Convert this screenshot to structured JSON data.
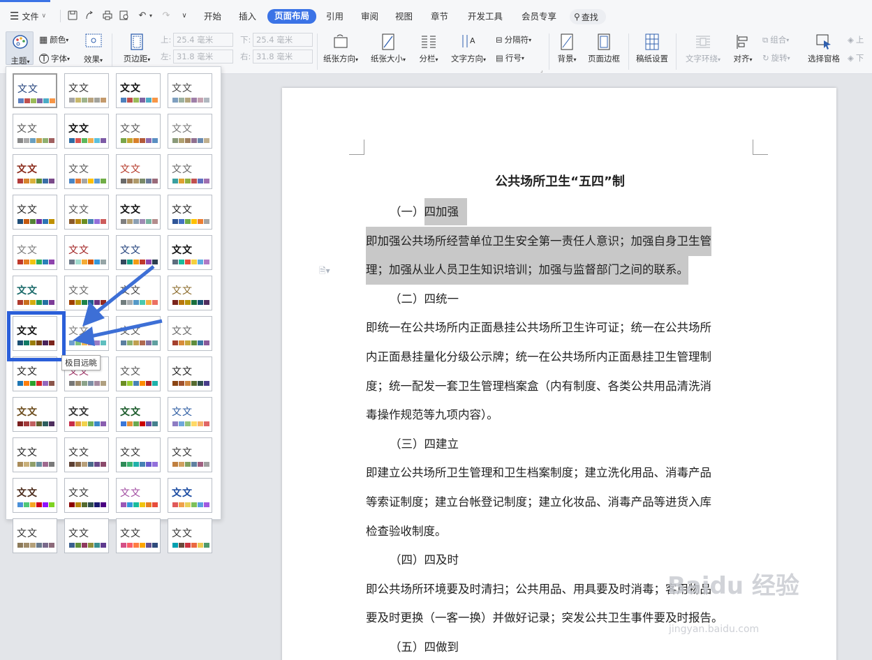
{
  "menu": {
    "file_label": "文件"
  },
  "tabs": [
    {
      "label": "开始"
    },
    {
      "label": "插入"
    },
    {
      "label": "页面布局",
      "active": true
    },
    {
      "label": "引用"
    },
    {
      "label": "审阅"
    },
    {
      "label": "视图"
    },
    {
      "label": "章节"
    },
    {
      "label": "开发工具"
    },
    {
      "label": "会员专享"
    }
  ],
  "search": {
    "label": "查找"
  },
  "ribbon": {
    "theme": "主题",
    "color": "颜色",
    "font": "字体",
    "effect": "效果",
    "margins": "页边距",
    "top_label": "上:",
    "top_value": "25.4 毫米",
    "bottom_label": "下:",
    "bottom_value": "25.4 毫米",
    "left_label": "左:",
    "left_value": "31.8 毫米",
    "right_label": "右:",
    "right_value": "31.8 毫米",
    "orientation": "纸张方向",
    "size": "纸张大小",
    "columns": "分栏",
    "text_direction": "文字方向",
    "separator": "分隔符",
    "line_numbers": "行号",
    "background": "背景",
    "page_border": "页面边框",
    "manuscript": "稿纸设置",
    "wrap": "文字环绕",
    "align": "对齐",
    "group": "组合",
    "rotate": "旋转",
    "select_pane": "选择窗格",
    "move_up": "上",
    "move_down": "下"
  },
  "theme_panel": {
    "sample_text": "文文",
    "tooltip": "极目远眺",
    "themes": [
      {
        "colors": [
          "#5b7fbf",
          "#c0504d",
          "#9bbb59",
          "#8064a2",
          "#4bacc6",
          "#f79646"
        ]
      },
      {
        "colors": [
          "#a5a5a5",
          "#c8b86b",
          "#9fb48c",
          "#b9a37e",
          "#a3a39c",
          "#c49a6c"
        ]
      },
      {
        "colors": [
          "#4f81bd",
          "#c0504d",
          "#9bbb59",
          "#8064a2",
          "#4bacc6",
          "#f79646"
        ]
      },
      {
        "colors": [
          "#7f9fbf",
          "#9db1a0",
          "#b4a57d",
          "#9f7fa8",
          "#c6a3b1",
          "#b0b8c0"
        ]
      },
      {
        "colors": [
          "#888888",
          "#aaaaaa",
          "#6a9fbf",
          "#c8a050",
          "#8fb070",
          "#a06060"
        ]
      },
      {
        "colors": [
          "#2e6da4",
          "#d9534f",
          "#5cb85c",
          "#f0ad4e",
          "#5bc0de",
          "#7d5ba6"
        ]
      },
      {
        "colors": [
          "#7aa64a",
          "#c6a532",
          "#d9802a",
          "#b35a3a",
          "#8c6bb0",
          "#5a8fc2"
        ]
      },
      {
        "colors": [
          "#8a9a7a",
          "#b0a070",
          "#a08060",
          "#907090",
          "#6a8ab0",
          "#c0b090"
        ]
      },
      {
        "colors": [
          "#b33a3a",
          "#d7842f",
          "#d9b13b",
          "#5a8f3a",
          "#3a6fa8",
          "#7a4a8a"
        ]
      },
      {
        "colors": [
          "#4a86c5",
          "#e07b39",
          "#a5a5a5",
          "#ffc000",
          "#5b9bd5",
          "#70ad47"
        ]
      },
      {
        "colors": [
          "#6a6a6a",
          "#9a7a5a",
          "#b09a6a",
          "#7a8a6a",
          "#6a7a9a",
          "#9a6a7a"
        ]
      },
      {
        "colors": [
          "#3aa0a0",
          "#e0a030",
          "#90b040",
          "#c05050",
          "#6070c0",
          "#a070b0"
        ]
      },
      {
        "colors": [
          "#1f4e79",
          "#c55a11",
          "#548235",
          "#7030a0",
          "#2e75b6",
          "#bf9000"
        ]
      },
      {
        "colors": [
          "#8b5a2b",
          "#b8860b",
          "#6b8e23",
          "#4682b4",
          "#9370db",
          "#cd5c5c"
        ]
      },
      {
        "colors": [
          "#7f7f7f",
          "#b4a078",
          "#8ca0b4",
          "#a08cb4",
          "#78b4a0",
          "#b48c8c"
        ]
      },
      {
        "colors": [
          "#2f5597",
          "#4472c4",
          "#70ad47",
          "#ffc000",
          "#ed7d31",
          "#a5a5a5"
        ]
      },
      {
        "colors": [
          "#c0392b",
          "#e67e22",
          "#f1c40f",
          "#27ae60",
          "#2980b9",
          "#8e44ad"
        ]
      },
      {
        "colors": [
          "#6c7a89",
          "#a2ded0",
          "#f5ab35",
          "#d35400",
          "#3498db",
          "#95a5a6"
        ]
      },
      {
        "colors": [
          "#34495e",
          "#16a085",
          "#f39c12",
          "#c0392b",
          "#8e44ad",
          "#2c3e50"
        ]
      },
      {
        "colors": [
          "#5d6d7e",
          "#1abc9c",
          "#e74c3c",
          "#f4d03f",
          "#5dade2",
          "#af7ac5"
        ]
      },
      {
        "colors": [
          "#b03a2e",
          "#ca6f1e",
          "#d4ac0d",
          "#229954",
          "#2471a3",
          "#7d3c98"
        ]
      },
      {
        "colors": [
          "#a04000",
          "#b7950b",
          "#1e8449",
          "#1f618d",
          "#6c3483",
          "#922b21"
        ]
      },
      {
        "colors": [
          "#717d7e",
          "#a6acaf",
          "#5499c7",
          "#48c9b0",
          "#f5b041",
          "#ec7063"
        ]
      },
      {
        "colors": [
          "#7b241c",
          "#b9770e",
          "#b7950b",
          "#196f3d",
          "#1a5276",
          "#512e5f"
        ]
      },
      {
        "colors": [
          "#1b4f72",
          "#117a65",
          "#9a7d0a",
          "#784212",
          "#4a235a",
          "#7b241c"
        ]
      },
      {
        "colors": [
          "#6e9ecf",
          "#7ec07e",
          "#efb54f",
          "#e0745a",
          "#9b7dc4",
          "#5fbfbf"
        ]
      },
      {
        "colors": [
          "#5a7fa0",
          "#8ab070",
          "#c0a050",
          "#b06a50",
          "#8070a0",
          "#60a0a0"
        ]
      },
      {
        "colors": [
          "#a5402d",
          "#d88c3a",
          "#c7a73c",
          "#5f8d3e",
          "#3b76a5",
          "#8a5a9a"
        ]
      },
      {
        "colors": [
          "#1f77b4",
          "#ff7f0e",
          "#2ca02c",
          "#d62728",
          "#9467bd",
          "#8c564b"
        ]
      },
      {
        "colors": [
          "#777777",
          "#9c8a6c",
          "#8ca38a",
          "#7d8fa6",
          "#a68ba0",
          "#b0a080"
        ]
      },
      {
        "colors": [
          "#6b8e23",
          "#9acd32",
          "#4682b4",
          "#ff8c00",
          "#b22222",
          "#20b2aa"
        ]
      },
      {
        "colors": [
          "#8b4513",
          "#a0522d",
          "#cd853f",
          "#556b2f",
          "#2f4f4f",
          "#483d8b"
        ]
      },
      {
        "colors": [
          "#7a1f1f",
          "#a33b3b",
          "#c06060",
          "#5f5f2f",
          "#2f5f5f",
          "#4f2f5f"
        ]
      },
      {
        "colors": [
          "#c72c48",
          "#e8a33d",
          "#f2d24b",
          "#6fb05a",
          "#3a89c9",
          "#8a5fb0"
        ]
      },
      {
        "colors": [
          "#3c78d8",
          "#e69138",
          "#6aa84f",
          "#cc0000",
          "#674ea7",
          "#45818e"
        ]
      },
      {
        "colors": [
          "#8e7cc3",
          "#6fa8dc",
          "#93c47d",
          "#ffd966",
          "#f6b26b",
          "#e06666"
        ]
      },
      {
        "colors": [
          "#a98c5a",
          "#c9b07a",
          "#8f9f6a",
          "#6a8f9f",
          "#9f6a8f",
          "#7a7a7a"
        ]
      },
      {
        "colors": [
          "#5c4033",
          "#8b6b4a",
          "#b8a07a",
          "#4a6b8b",
          "#6b4a8b",
          "#8b4a6b"
        ]
      },
      {
        "colors": [
          "#2e8b57",
          "#3cb371",
          "#20b2aa",
          "#4682b4",
          "#6a5acd",
          "#9370db"
        ]
      },
      {
        "colors": [
          "#c08040",
          "#d0a060",
          "#80a060",
          "#6080a0",
          "#a06080",
          "#a0a0a0"
        ]
      },
      {
        "colors": [
          "#4a90d9",
          "#50c878",
          "#f5a623",
          "#d0021b",
          "#9013fe",
          "#7ed321"
        ]
      },
      {
        "colors": [
          "#8b0000",
          "#b8860b",
          "#556b2f",
          "#2f4f4f",
          "#191970",
          "#4b0082"
        ]
      },
      {
        "colors": [
          "#9b59b6",
          "#3498db",
          "#1abc9c",
          "#f1c40f",
          "#e67e22",
          "#e74c3c"
        ]
      },
      {
        "colors": [
          "#e05a5a",
          "#f0a04b",
          "#e8d05a",
          "#7cc05a",
          "#5aa0e0",
          "#a05ae0"
        ]
      },
      {
        "colors": [
          "#8c7a5a",
          "#a08c6a",
          "#b4a07a",
          "#6a7a8c",
          "#7a6a8c",
          "#8c6a7a"
        ]
      },
      {
        "colors": [
          "#3a5f8f",
          "#5f8f3a",
          "#8f3a5f",
          "#8f8f3a",
          "#3a8f8f",
          "#5f3a8f"
        ]
      },
      {
        "colors": [
          "#d45087",
          "#f95d6a",
          "#ff7c43",
          "#ffa600",
          "#665191",
          "#2f4b7c"
        ]
      },
      {
        "colors": [
          "#00a0b0",
          "#6a4a3c",
          "#cc333f",
          "#eb6841",
          "#edc951",
          "#4f9a6a"
        ]
      }
    ]
  },
  "document": {
    "title": "公共场所卫生“五四”制",
    "lines": [
      {
        "text": "（一）四加强",
        "kind": "heading",
        "highlight": true
      },
      {
        "text": "即加强公共场所经营单位卫生安全第一责任人意识；加强自身卫生管",
        "kind": "body",
        "highlight": true
      },
      {
        "text": "理；加强从业人员卫生知识培训；加强与监督部门之间的联系。",
        "kind": "body",
        "highlight": true
      },
      {
        "text": "（二）四统一",
        "kind": "heading"
      },
      {
        "text": "即统一在公共场所内正面悬挂公共场所卫生许可证；统一在公共场所",
        "kind": "body"
      },
      {
        "text": "内正面悬挂量化分级公示牌；统一在公共场所内正面悬挂卫生管理制",
        "kind": "body"
      },
      {
        "text": "度；统一配发一套卫生管理档案盒（内有制度、各类公共用品清洗消",
        "kind": "body"
      },
      {
        "text": "毒操作规范等九项内容）。",
        "kind": "body"
      },
      {
        "text": "（三）四建立",
        "kind": "heading"
      },
      {
        "text": "即建立公共场所卫生管理和卫生档案制度；建立洗化用品、消毒产品",
        "kind": "body"
      },
      {
        "text": "等索证制度；建立台帐登记制度；建立化妆品、消毒产品等进货入库",
        "kind": "body"
      },
      {
        "text": "检查验收制度。",
        "kind": "body"
      },
      {
        "text": "（四）四及时",
        "kind": "heading"
      },
      {
        "text": "即公共场所环境要及时清扫；公共用品、用具要及时消毒；客用物品",
        "kind": "body"
      },
      {
        "text": "要及时更换（一客一换）并做好记录；突发公共卫生事件要及时报告。",
        "kind": "body"
      },
      {
        "text": "（五）四做到",
        "kind": "heading"
      }
    ]
  },
  "watermark": {
    "brand": "Baidu 经验",
    "url": "jingyan.baidu.com"
  }
}
